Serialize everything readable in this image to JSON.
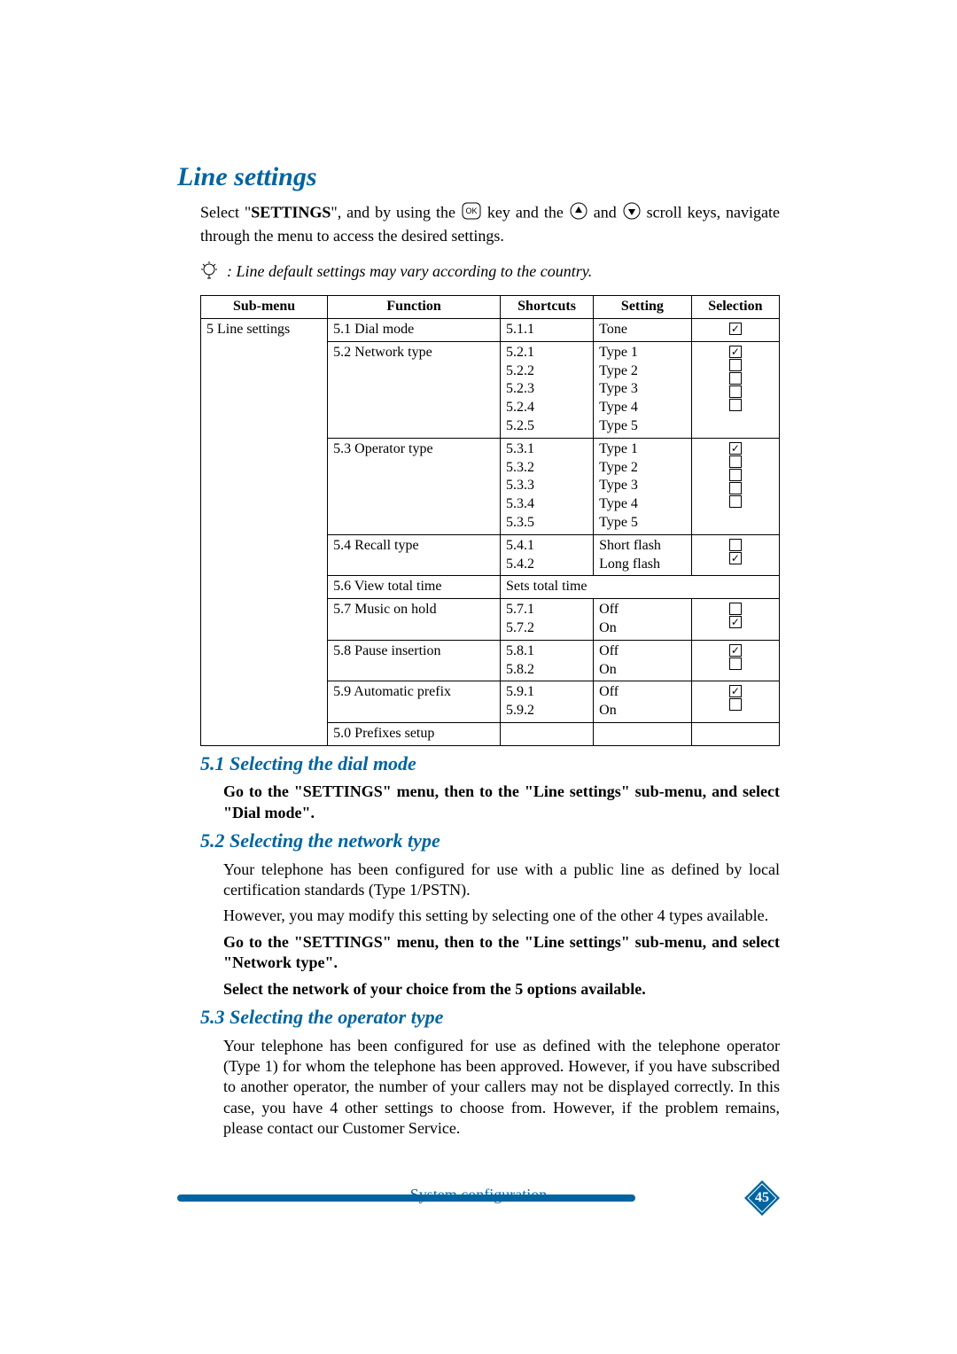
{
  "heading": "Line settings",
  "intro_pre": "Select \"",
  "intro_settings_word": "SETTINGS",
  "intro_mid1": "\", and by using the ",
  "intro_mid2": " key and the ",
  "intro_mid3": " and ",
  "intro_post": " scroll keys, navigate through the menu to access the desired settings.",
  "note_prefix": ":  ",
  "note": "Line default settings may vary according to the country.",
  "table": {
    "headers": {
      "submenu": "Sub-menu",
      "function": "Function",
      "shortcuts": "Shortcuts",
      "setting": "Setting",
      "selection": "Selection"
    },
    "submenu_label": "5 Line settings",
    "rows": [
      {
        "function": "5.1 Dial mode",
        "shortcuts": [
          "5.1.1"
        ],
        "settings": [
          "Tone"
        ],
        "selected": [
          true
        ]
      },
      {
        "function": "5.2 Network type",
        "shortcuts": [
          "5.2.1",
          "5.2.2",
          "5.2.3",
          "5.2.4",
          "5.2.5"
        ],
        "settings": [
          "Type 1",
          "Type 2",
          "Type 3",
          "Type 4",
          "Type 5"
        ],
        "selected": [
          true,
          false,
          false,
          false,
          false
        ]
      },
      {
        "function": "5.3 Operator  type",
        "shortcuts": [
          "5.3.1",
          "5.3.2",
          "5.3.3",
          "5.3.4",
          "5.3.5"
        ],
        "settings": [
          "Type 1",
          "Type 2",
          "Type 3",
          "Type 4",
          "Type 5"
        ],
        "selected": [
          true,
          false,
          false,
          false,
          false
        ]
      },
      {
        "function": "5.4 Recall type",
        "shortcuts": [
          "5.4.1",
          "5.4.2"
        ],
        "settings": [
          "Short flash",
          "Long flash"
        ],
        "selected": [
          false,
          true
        ]
      },
      {
        "function": "5.6 View total time",
        "span_text": "Sets total time"
      },
      {
        "function": "5.7 Music on hold",
        "shortcuts": [
          "5.7.1",
          "5.7.2"
        ],
        "settings": [
          "Off",
          "On"
        ],
        "selected": [
          false,
          true
        ]
      },
      {
        "function": "5.8 Pause insertion",
        "shortcuts": [
          "5.8.1",
          "5.8.2"
        ],
        "settings": [
          "Off",
          "On"
        ],
        "selected": [
          true,
          false
        ]
      },
      {
        "function": "5.9 Automatic prefix",
        "shortcuts": [
          "5.9.1",
          "5.9.2"
        ],
        "settings": [
          "Off",
          "On"
        ],
        "selected": [
          true,
          false
        ]
      },
      {
        "function": "5.0 Prefixes setup",
        "shortcuts": [
          ""
        ],
        "settings": [
          ""
        ],
        "selected": []
      }
    ]
  },
  "s51": {
    "title": "5.1 Selecting the dial mode",
    "p1": "Go to the \"SETTINGS\" menu, then to the \"Line settings\" sub-menu, and select \"Dial mode\"."
  },
  "s52": {
    "title": "5.2 Selecting the network type",
    "p1": "Your telephone has been configured for use with a public line as defined by local certification standards (Type 1/PSTN).",
    "p2": "However, you may modify this setting by selecting one of the other 4 types available.",
    "p3": "Go to the \"SETTINGS\" menu, then to the \"Line settings\" sub-menu, and select \"Network type\".",
    "p4": "Select the network of your choice from the 5 options available."
  },
  "s53": {
    "title": "5.3 Selecting the operator type",
    "p1": "Your telephone has been configured for use as defined with the telephone operator (Type 1) for whom the telephone has been approved. However, if you have subscribed to another operator, the number of your callers may not be displayed correctly. In this case, you have 4 other settings to choose from. However, if the problem remains, please contact our Customer Service."
  },
  "footer": {
    "label": "System configuration",
    "page": "45"
  },
  "icons": {
    "ok_label": "OK"
  }
}
